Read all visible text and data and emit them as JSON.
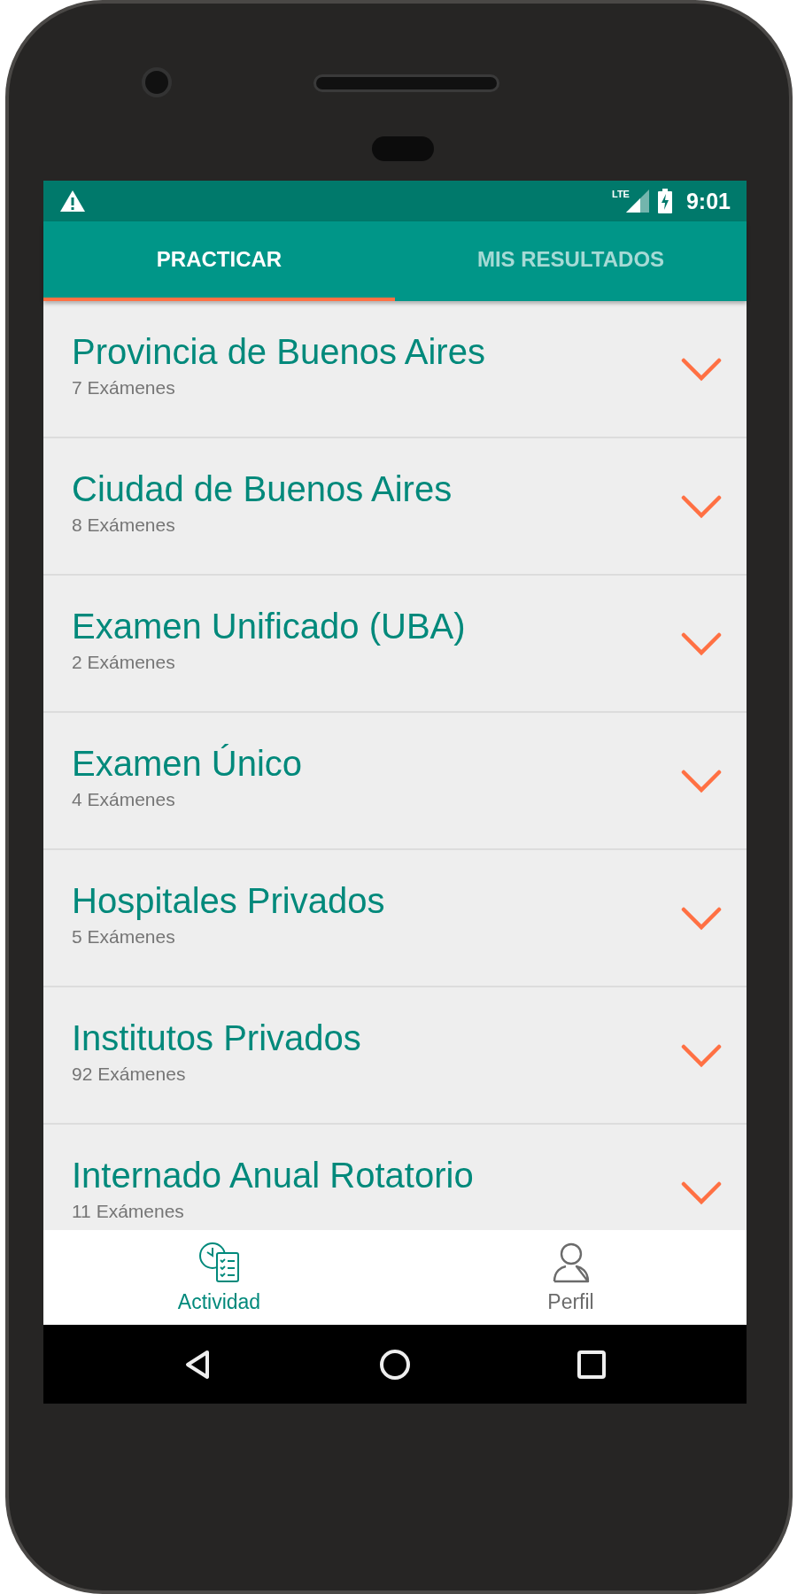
{
  "status_bar": {
    "network": "LTE",
    "time": "9:01"
  },
  "tabs": [
    {
      "label": "PRACTICAR",
      "selected": true
    },
    {
      "label": "MIS RESULTADOS",
      "selected": false
    }
  ],
  "categories": [
    {
      "title": "Provincia de Buenos Aires",
      "count": "7 Exámenes"
    },
    {
      "title": "Ciudad de Buenos Aires",
      "count": "8 Exámenes"
    },
    {
      "title": "Examen Unificado (UBA)",
      "count": "2 Exámenes"
    },
    {
      "title": "Examen Único",
      "count": "4 Exámenes"
    },
    {
      "title": "Hospitales Privados",
      "count": "5 Exámenes"
    },
    {
      "title": "Institutos Privados",
      "count": "92 Exámenes"
    },
    {
      "title": "Internado Anual Rotatorio",
      "count": "11 Exámenes"
    }
  ],
  "bottom_nav": [
    {
      "kind": "activity",
      "label": "Actividad",
      "selected": true
    },
    {
      "kind": "profile",
      "label": "Perfil",
      "selected": false
    }
  ],
  "system_nav": [
    {
      "kind": "back"
    },
    {
      "kind": "home"
    },
    {
      "kind": "recents"
    }
  ]
}
